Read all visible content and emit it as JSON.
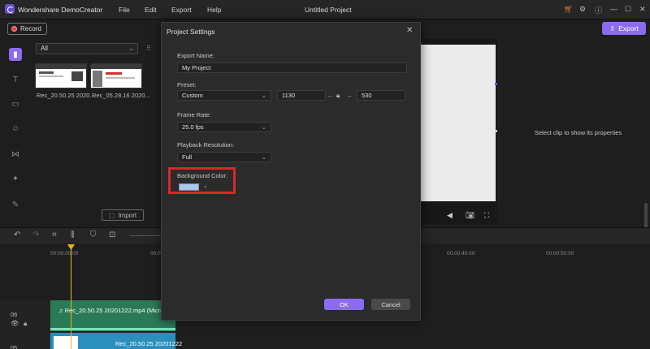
{
  "app": {
    "title": "Wondershare DemoCreator",
    "document_title": "Untitled Project",
    "menu": [
      "File",
      "Edit",
      "Export",
      "Help"
    ]
  },
  "toolbar": {
    "record_label": "Record",
    "export_label": "Export"
  },
  "media": {
    "filter_value": "All",
    "items": [
      {
        "name": "Rec_20.50.25 2020..."
      },
      {
        "name": "Rec_05.28.16 2020..."
      }
    ],
    "import_label": "Import"
  },
  "properties": {
    "empty_text": "Select clip to show its properties"
  },
  "timeline": {
    "ruler": [
      "00:00:00:00",
      "00:00:10:00",
      "00:00:40:00",
      "00:00:50:00"
    ],
    "tracks": [
      {
        "number": "06",
        "clip_label": "Rec_20.50.25 20201222.mp4 (Microph"
      },
      {
        "number": "05",
        "clip_label": "Rec_20.50.25 20201222"
      }
    ]
  },
  "dialog": {
    "title": "Project Settings",
    "export_name_label": "Export Name:",
    "export_name_value": "My Project",
    "preset_label": "Preset:",
    "preset_value": "Custom",
    "width_value": "1130",
    "height_value": "530",
    "frame_rate_label": "Frame Rate:",
    "frame_rate_value": "25.0 fps",
    "playback_label": "Playback Resolution:",
    "playback_value": "Full",
    "background_label": "Background Color:",
    "background_color": "#a8c8ec",
    "ok_label": "OK",
    "cancel_label": "Cancel"
  },
  "colors": {
    "accent": "#8b6cf0",
    "highlight": "#d8282a",
    "audio_clip": "#2a7a58",
    "video_clip": "#2b8fbe",
    "playhead": "#e8b21a"
  }
}
